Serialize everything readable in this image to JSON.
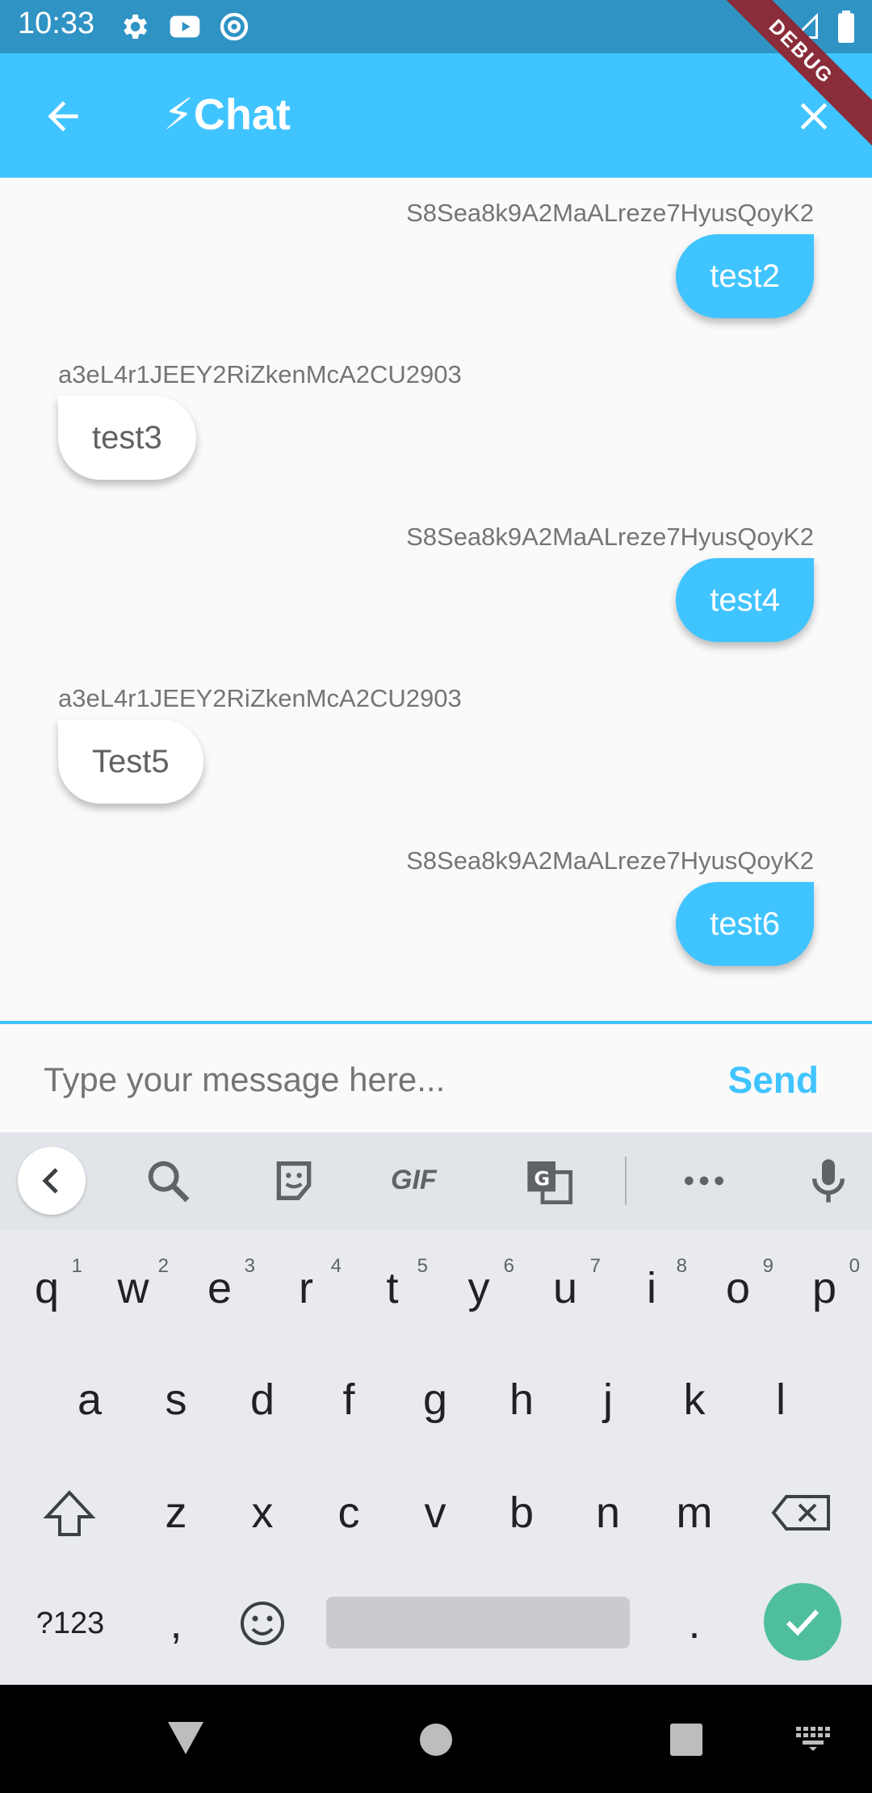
{
  "status_bar": {
    "time": "10:33",
    "icons": [
      "gear-icon",
      "youtube-icon",
      "at-sign-icon",
      "wifi-icon",
      "signal-icon",
      "battery-icon"
    ],
    "debug_label": "DEBUG"
  },
  "app_bar": {
    "title": "⚡Chat",
    "back_icon": "arrow-left-icon",
    "close_icon": "close-icon",
    "color": "#40c4ff"
  },
  "messages": [
    {
      "sender": "S8Sea8k9A2MaALreze7HyusQoyK2",
      "text": "test2",
      "direction": "sent"
    },
    {
      "sender": "a3eL4r1JEEY2RiZkenMcA2CU2903",
      "text": "test3",
      "direction": "received"
    },
    {
      "sender": "S8Sea8k9A2MaALreze7HyusQoyK2",
      "text": "test4",
      "direction": "sent"
    },
    {
      "sender": "a3eL4r1JEEY2RiZkenMcA2CU2903",
      "text": "Test5",
      "direction": "received"
    },
    {
      "sender": "S8Sea8k9A2MaALreze7HyusQoyK2",
      "text": "test6",
      "direction": "sent"
    }
  ],
  "composer": {
    "placeholder": "Type your message here...",
    "value": "",
    "send_label": "Send"
  },
  "keyboard": {
    "toolbar": [
      "chevron-left-icon",
      "search-icon",
      "sticker-icon",
      "gif-icon",
      "translate-icon",
      "more-icon",
      "microphone-icon"
    ],
    "gif_label": "GIF",
    "row1": [
      "q",
      "w",
      "e",
      "r",
      "t",
      "y",
      "u",
      "i",
      "o",
      "p"
    ],
    "row1_hints": [
      "1",
      "2",
      "3",
      "4",
      "5",
      "6",
      "7",
      "8",
      "9",
      "0"
    ],
    "row2": [
      "a",
      "s",
      "d",
      "f",
      "g",
      "h",
      "j",
      "k",
      "l"
    ],
    "row3": [
      "z",
      "x",
      "c",
      "v",
      "b",
      "n",
      "m"
    ],
    "symbols_label": "?123",
    "comma": ",",
    "period": ".",
    "enter_color": "#4fbe9f"
  },
  "nav_bar": {
    "icons": [
      "back-triangle-icon",
      "home-circle-icon",
      "recents-square-icon",
      "keyboard-switch-icon"
    ]
  }
}
